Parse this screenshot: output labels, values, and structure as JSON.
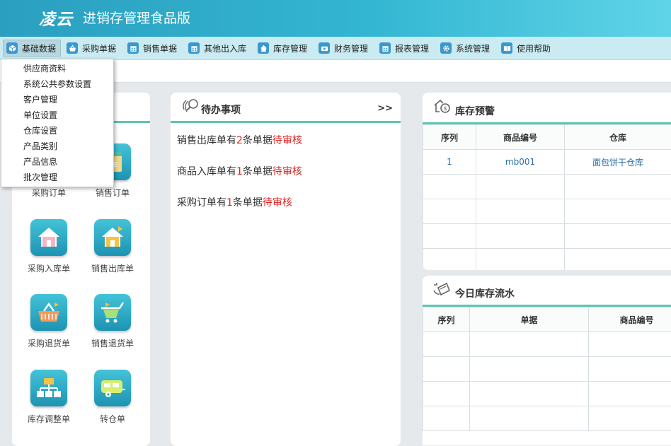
{
  "header": {
    "logo": "凌云",
    "title": "进销存管理食品版"
  },
  "menu": [
    {
      "label": "基础数据",
      "icon": "cube-icon"
    },
    {
      "label": "采购单据",
      "icon": "basket-icon"
    },
    {
      "label": "销售单据",
      "icon": "calendar-icon"
    },
    {
      "label": "其他出入库",
      "icon": "calendar-icon"
    },
    {
      "label": "库存管理",
      "icon": "home-icon"
    },
    {
      "label": "财务管理",
      "icon": "finance-icon"
    },
    {
      "label": "报表管理",
      "icon": "calendar-icon"
    },
    {
      "label": "系统管理",
      "icon": "gear-icon"
    },
    {
      "label": "使用帮助",
      "icon": "book-icon"
    }
  ],
  "dropdown": [
    "供应商资料",
    "系统公共参数设置",
    "客户管理",
    "单位设置",
    "仓库设置",
    "产品类别",
    "产品信息",
    "批次管理"
  ],
  "quick_tiles": [
    {
      "label": "采购订单",
      "icon": "purchase-order-icon"
    },
    {
      "label": "销售订单",
      "icon": "sale-tag-icon"
    },
    {
      "label": "采购入库单",
      "icon": "house-in-icon"
    },
    {
      "label": "销售出库单",
      "icon": "house-out-icon"
    },
    {
      "label": "采购退货单",
      "icon": "basket-return-icon"
    },
    {
      "label": "销售退货单",
      "icon": "cart-return-icon"
    },
    {
      "label": "库存调整单",
      "icon": "org-chart-icon"
    },
    {
      "label": "转仓单",
      "icon": "trailer-icon"
    }
  ],
  "todo": {
    "title": "待办事项",
    "more": ">>",
    "items": [
      {
        "prefix": "销售出库单有",
        "count": "2",
        "mid": "条单据",
        "status": "待审核"
      },
      {
        "prefix": "商品入库单有",
        "count": "1",
        "mid": "条单据",
        "status": "待审核"
      },
      {
        "prefix": "采购订单有",
        "count": "1",
        "mid": "条单据",
        "status": "待审核"
      }
    ]
  },
  "stock_warning": {
    "title": "库存预警",
    "columns": [
      "序列",
      "商品编号",
      "仓库"
    ],
    "rows": [
      [
        "1",
        "mb001",
        "面包饼干仓库"
      ],
      [
        "",
        "",
        ""
      ],
      [
        "",
        "",
        ""
      ],
      [
        "",
        "",
        ""
      ],
      [
        "",
        "",
        ""
      ]
    ]
  },
  "daily_flow": {
    "title": "今日库存流水",
    "columns": [
      "序列",
      "单据",
      "商品编号"
    ],
    "rows": [
      [
        "",
        "",
        ""
      ],
      [
        "",
        "",
        ""
      ],
      [
        "",
        "",
        ""
      ],
      [
        "",
        "",
        ""
      ]
    ]
  },
  "colors": {
    "header_start": "#2b9fc0",
    "accent_bar": "#5cc6b2",
    "alert_red": "#e02020",
    "link_blue": "#2a6fa8"
  }
}
